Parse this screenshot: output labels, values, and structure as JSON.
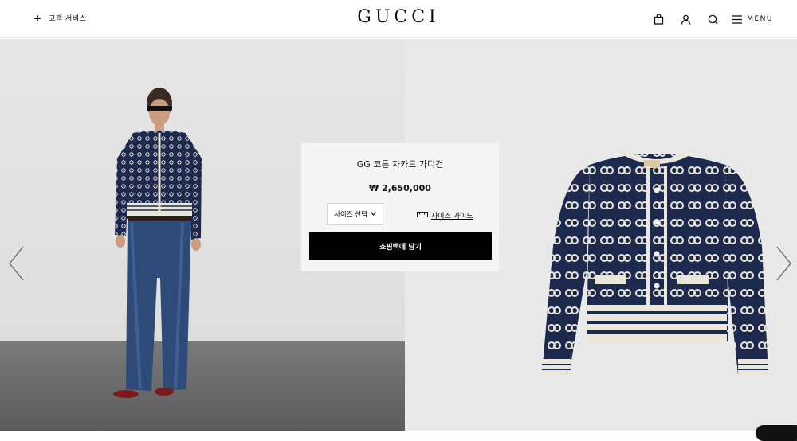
{
  "header": {
    "customer_service_label": "고객 서비스",
    "logo": "GUCCI",
    "menu_label": "MENU",
    "icons": [
      "shopping-bag-icon",
      "user-icon",
      "search-icon",
      "menu-icon"
    ]
  },
  "product": {
    "name": "GG 코튼 자카드 가디건",
    "price": "₩ 2,650,000",
    "size_select_label": "사이즈 선택",
    "size_guide_label": "사이즈 가이드",
    "add_to_bag_label": "쇼핑백에 담기"
  },
  "images": {
    "left": "model-wearing-navy-gg-cardigan-and-jeans",
    "right": "navy-gg-jacquard-cardigan-product-shot"
  },
  "colors": {
    "accent": "#000000",
    "cardigan_navy": "#1e2a4d",
    "cardigan_trim": "#e9e6dc"
  }
}
